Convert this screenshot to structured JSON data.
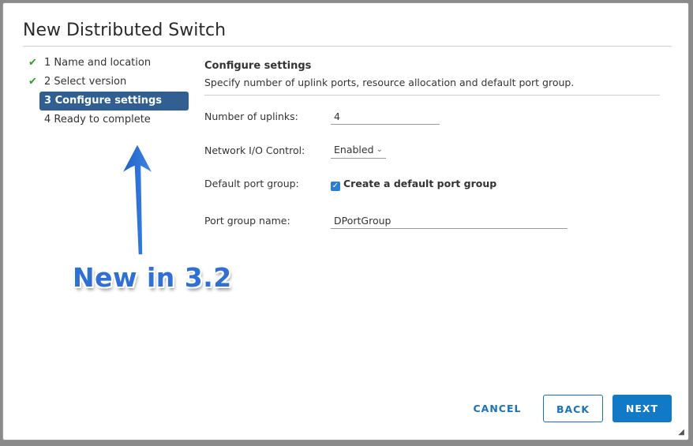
{
  "dialog": {
    "title": "New Distributed Switch"
  },
  "steps": [
    {
      "label": "1 Name and location",
      "status": "done"
    },
    {
      "label": "2 Select version",
      "status": "done"
    },
    {
      "label": "3 Configure settings",
      "status": "active"
    },
    {
      "label": "4 Ready to complete",
      "status": "pending"
    }
  ],
  "annotation": {
    "text": "New in 3.2",
    "color": "#2f6fd6"
  },
  "section": {
    "title": "Configure settings",
    "description": "Specify number of uplink ports, resource allocation and default port group."
  },
  "fields": {
    "uplinks_label": "Number of uplinks:",
    "uplinks_value": "4",
    "nioc_label": "Network I/O Control:",
    "nioc_value": "Enabled",
    "default_pg_label": "Default port group:",
    "default_pg_checkbox_label": "Create a default port group",
    "default_pg_checked": true,
    "pg_name_label": "Port group name:",
    "pg_name_value": "DPortGroup"
  },
  "buttons": {
    "cancel": "CANCEL",
    "back": "BACK",
    "next": "NEXT"
  },
  "colors": {
    "accent": "#1279c7",
    "active_step": "#325f91",
    "check": "#2f9e2f"
  }
}
